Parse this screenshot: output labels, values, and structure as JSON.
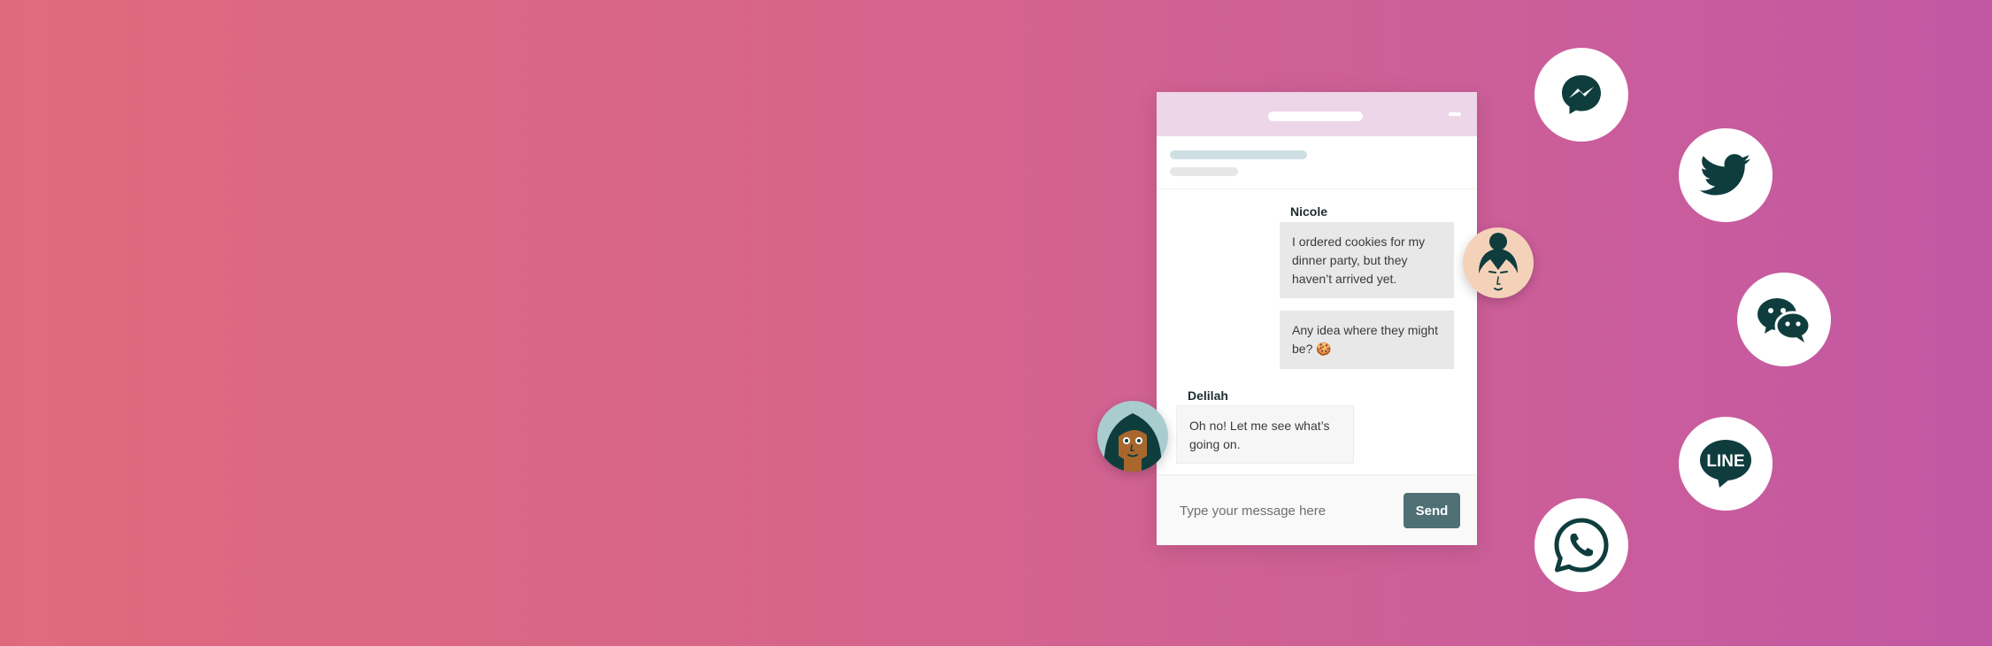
{
  "conversation": {
    "messages": [
      {
        "sender": "Nicole",
        "text": "I ordered cookies for my dinner party, but they haven’t arrived yet."
      },
      {
        "sender": "",
        "text": "Any idea where they might be? 🍪"
      },
      {
        "sender": "Delilah",
        "text": "Oh no! Let me see what’s going on."
      }
    ]
  },
  "composer": {
    "placeholder": "Type your message here",
    "send_label": "Send"
  },
  "channels": [
    {
      "icon": "messenger-icon"
    },
    {
      "icon": "twitter-icon"
    },
    {
      "icon": "wechat-icon"
    },
    {
      "icon": "line-icon",
      "label": "LINE"
    },
    {
      "icon": "whatsapp-icon"
    }
  ],
  "colors": {
    "gradient_start": "#e06a7d",
    "gradient_end": "#c258a3",
    "widget_header": "#ecd6e8",
    "send_button": "#4e7075",
    "icon_dark": "#0f3d3e"
  }
}
